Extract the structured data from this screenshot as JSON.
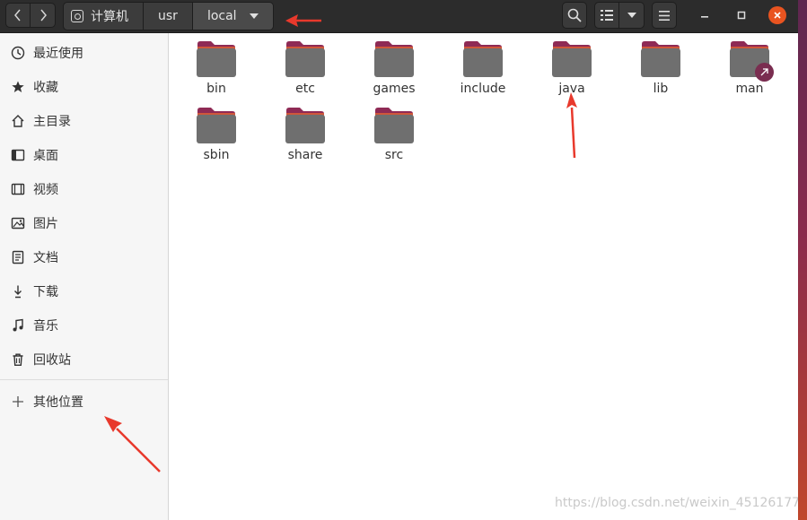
{
  "path": {
    "segments": [
      "计算机",
      "usr",
      "local"
    ]
  },
  "sidebar": {
    "items": [
      {
        "label": "最近使用",
        "icon": "clock-icon"
      },
      {
        "label": "收藏",
        "icon": "star-icon"
      },
      {
        "label": "主目录",
        "icon": "home-icon"
      },
      {
        "label": "桌面",
        "icon": "desktop-icon"
      },
      {
        "label": "视频",
        "icon": "video-icon"
      },
      {
        "label": "图片",
        "icon": "picture-icon"
      },
      {
        "label": "文档",
        "icon": "document-icon"
      },
      {
        "label": "下载",
        "icon": "download-icon"
      },
      {
        "label": "音乐",
        "icon": "music-icon"
      },
      {
        "label": "回收站",
        "icon": "trash-icon"
      }
    ],
    "other_locations": {
      "label": "其他位置",
      "icon": "plus-icon"
    }
  },
  "files": [
    {
      "name": "bin",
      "symlink": false
    },
    {
      "name": "etc",
      "symlink": false
    },
    {
      "name": "games",
      "symlink": false
    },
    {
      "name": "include",
      "symlink": false
    },
    {
      "name": "java",
      "symlink": false
    },
    {
      "name": "lib",
      "symlink": false
    },
    {
      "name": "man",
      "symlink": true
    },
    {
      "name": "sbin",
      "symlink": false
    },
    {
      "name": "share",
      "symlink": false
    },
    {
      "name": "src",
      "symlink": false
    }
  ],
  "watermark": "https://blog.csdn.net/weixin_45126177",
  "colors": {
    "accent": "#e95420",
    "folder_body": "#6f6f6f",
    "folder_tab": "#8f2a55",
    "annotation_arrow": "#e8392c"
  }
}
